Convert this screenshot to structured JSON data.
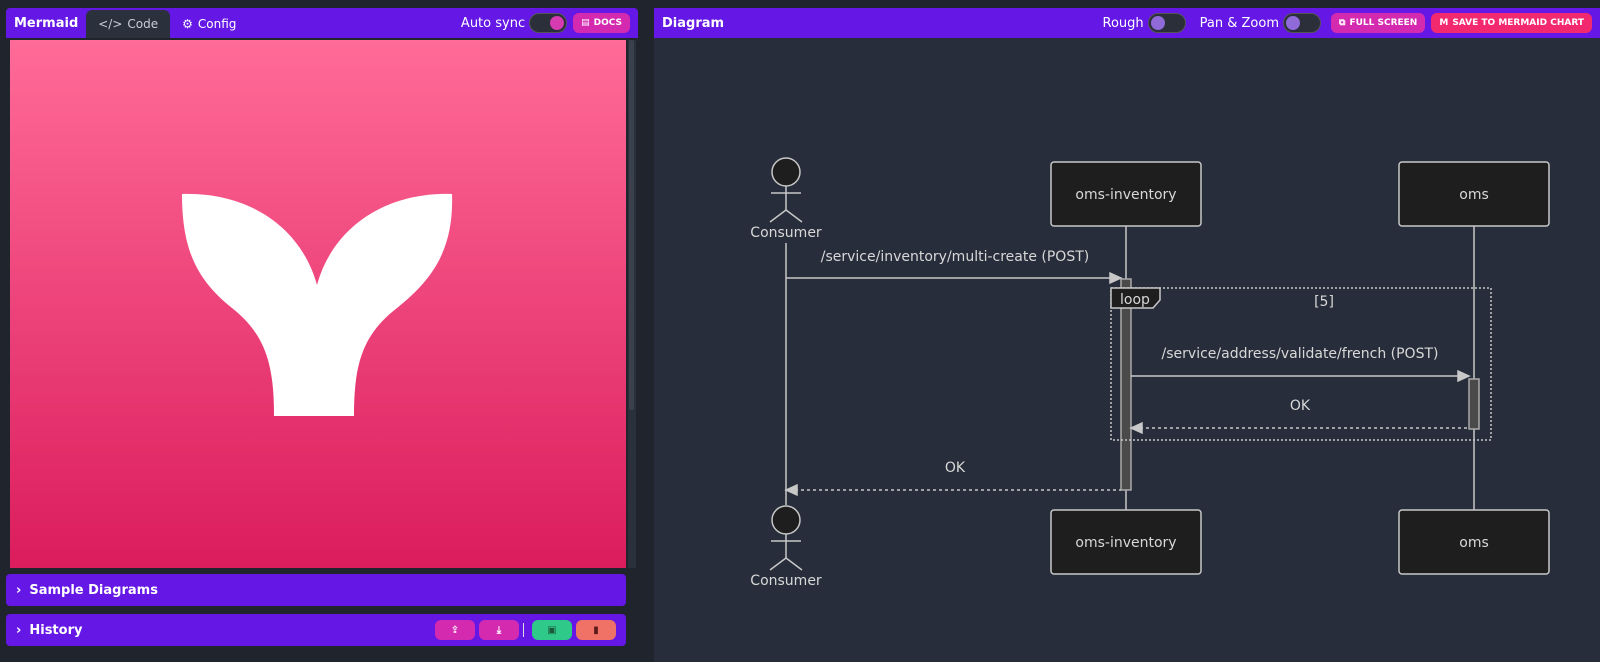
{
  "app": {
    "brand": "Mermaid",
    "tabs": [
      {
        "label": "Code",
        "icon": "code-icon",
        "active": true
      },
      {
        "label": "Config",
        "icon": "gears-icon",
        "active": false
      }
    ],
    "auto_sync_label": "Auto sync",
    "auto_sync_on": true,
    "docs_label": "DOCS"
  },
  "sections": {
    "sample_diagrams": "Sample Diagrams",
    "history": "History",
    "history_buttons": [
      {
        "name": "upload",
        "icon": "upload-icon",
        "color": "#d42ab0"
      },
      {
        "name": "download",
        "icon": "download-icon",
        "color": "#d42ab0"
      },
      {
        "name": "save",
        "icon": "save-icon",
        "color": "#2fc98a"
      },
      {
        "name": "delete",
        "icon": "trash-icon",
        "color": "#f07166"
      }
    ]
  },
  "diagram": {
    "title": "Diagram",
    "rough_label": "Rough",
    "rough_on": false,
    "panzoom_label": "Pan & Zoom",
    "panzoom_on": false,
    "fullscreen_label": "FULL SCREEN",
    "save_label": "SAVE TO MERMAID CHART",
    "participants": {
      "consumer": "Consumer",
      "inventory": "oms-inventory",
      "oms": "oms"
    },
    "messages": {
      "m1": "/service/inventory/multi-create (POST)",
      "m2": "/service/address/validate/french (POST)",
      "m3": "OK",
      "m4": "OK"
    },
    "loop": {
      "label": "loop",
      "condition": "[5]"
    }
  }
}
